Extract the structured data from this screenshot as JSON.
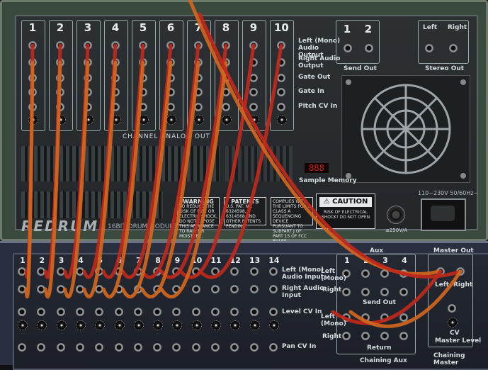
{
  "drum_module": {
    "channel_numbers": [
      "1",
      "2",
      "3",
      "4",
      "5",
      "6",
      "7",
      "8",
      "9",
      "10"
    ],
    "row_labels": {
      "left_mono_audio": "Left (Mono) Audio Output",
      "right_audio": "Right Audio Output",
      "gate_out": "Gate Out",
      "gate_in": "Gate In",
      "pitch_cv": "Pitch CV In"
    },
    "channel_section_label": "CHANNEL ANALOG OUT",
    "send_out": {
      "numbers": [
        "1",
        "2"
      ],
      "label": "Send Out"
    },
    "stereo_out": {
      "left": "Left",
      "right": "Right",
      "label": "Stereo Out"
    },
    "memory": {
      "display": "888",
      "label": "Sample Memory"
    },
    "logo": "REDRUM",
    "logo_sub": "16BIT DRUM MODULE",
    "warning": {
      "title": "WARNING",
      "text": "TO REDUCE THE RISK OF FIRE OR ELECTRIC SHOCK, DO NOT EXPOSE THIS APPLIANCE TO RAIN OR MOISTURE."
    },
    "patents": {
      "title": "PATENTS",
      "text": "U.S. PAT. No. 6324598, 6314568 AND OTHER PATENTS PENDING."
    },
    "compliance": "COMPLIES WITH THE LIMITS FOR A CLASS A SEQUENCING DEVICE PURSUANT TO SUBPART J OF PART 15 OF FCC RULES.",
    "caution": {
      "title": "CAUTION",
      "text": "RISK OF ELECTRICAL SHOCK! DO NOT OPEN"
    },
    "fuse_label": "≤250V/A",
    "power_label": "110~230V 50/60Hz~"
  },
  "mixer": {
    "channel_numbers": [
      "1",
      "2",
      "3",
      "4",
      "5",
      "6",
      "7",
      "8",
      "9",
      "10",
      "11",
      "12",
      "13",
      "14"
    ],
    "row_labels": {
      "left_mono_audio": "Left (Mono) Audio Input",
      "right_audio": "Right Audio Input",
      "level_cv": "Level CV In",
      "pan_cv": "Pan CV In"
    },
    "aux": {
      "label": "Aux",
      "numbers": [
        "1",
        "2",
        "3",
        "4"
      ],
      "left_mono": "Left (Mono)",
      "right": "Right",
      "send_out": "Send Out",
      "return": "Return",
      "left_mono_2": "Left (Mono)",
      "right_2": "Right"
    },
    "master_out": {
      "label": "Master Out",
      "left": "Left",
      "right": "Right",
      "cv": "CV",
      "cv_label": "Master Level"
    },
    "chaining_aux": "Chaining Aux",
    "chaining_master": "Chaining Master"
  },
  "colors": {
    "cable_red": "#c0281c",
    "cable_orange": "#d2661e",
    "drum_panel": "#2c3033",
    "mixer_panel": "#242832"
  }
}
